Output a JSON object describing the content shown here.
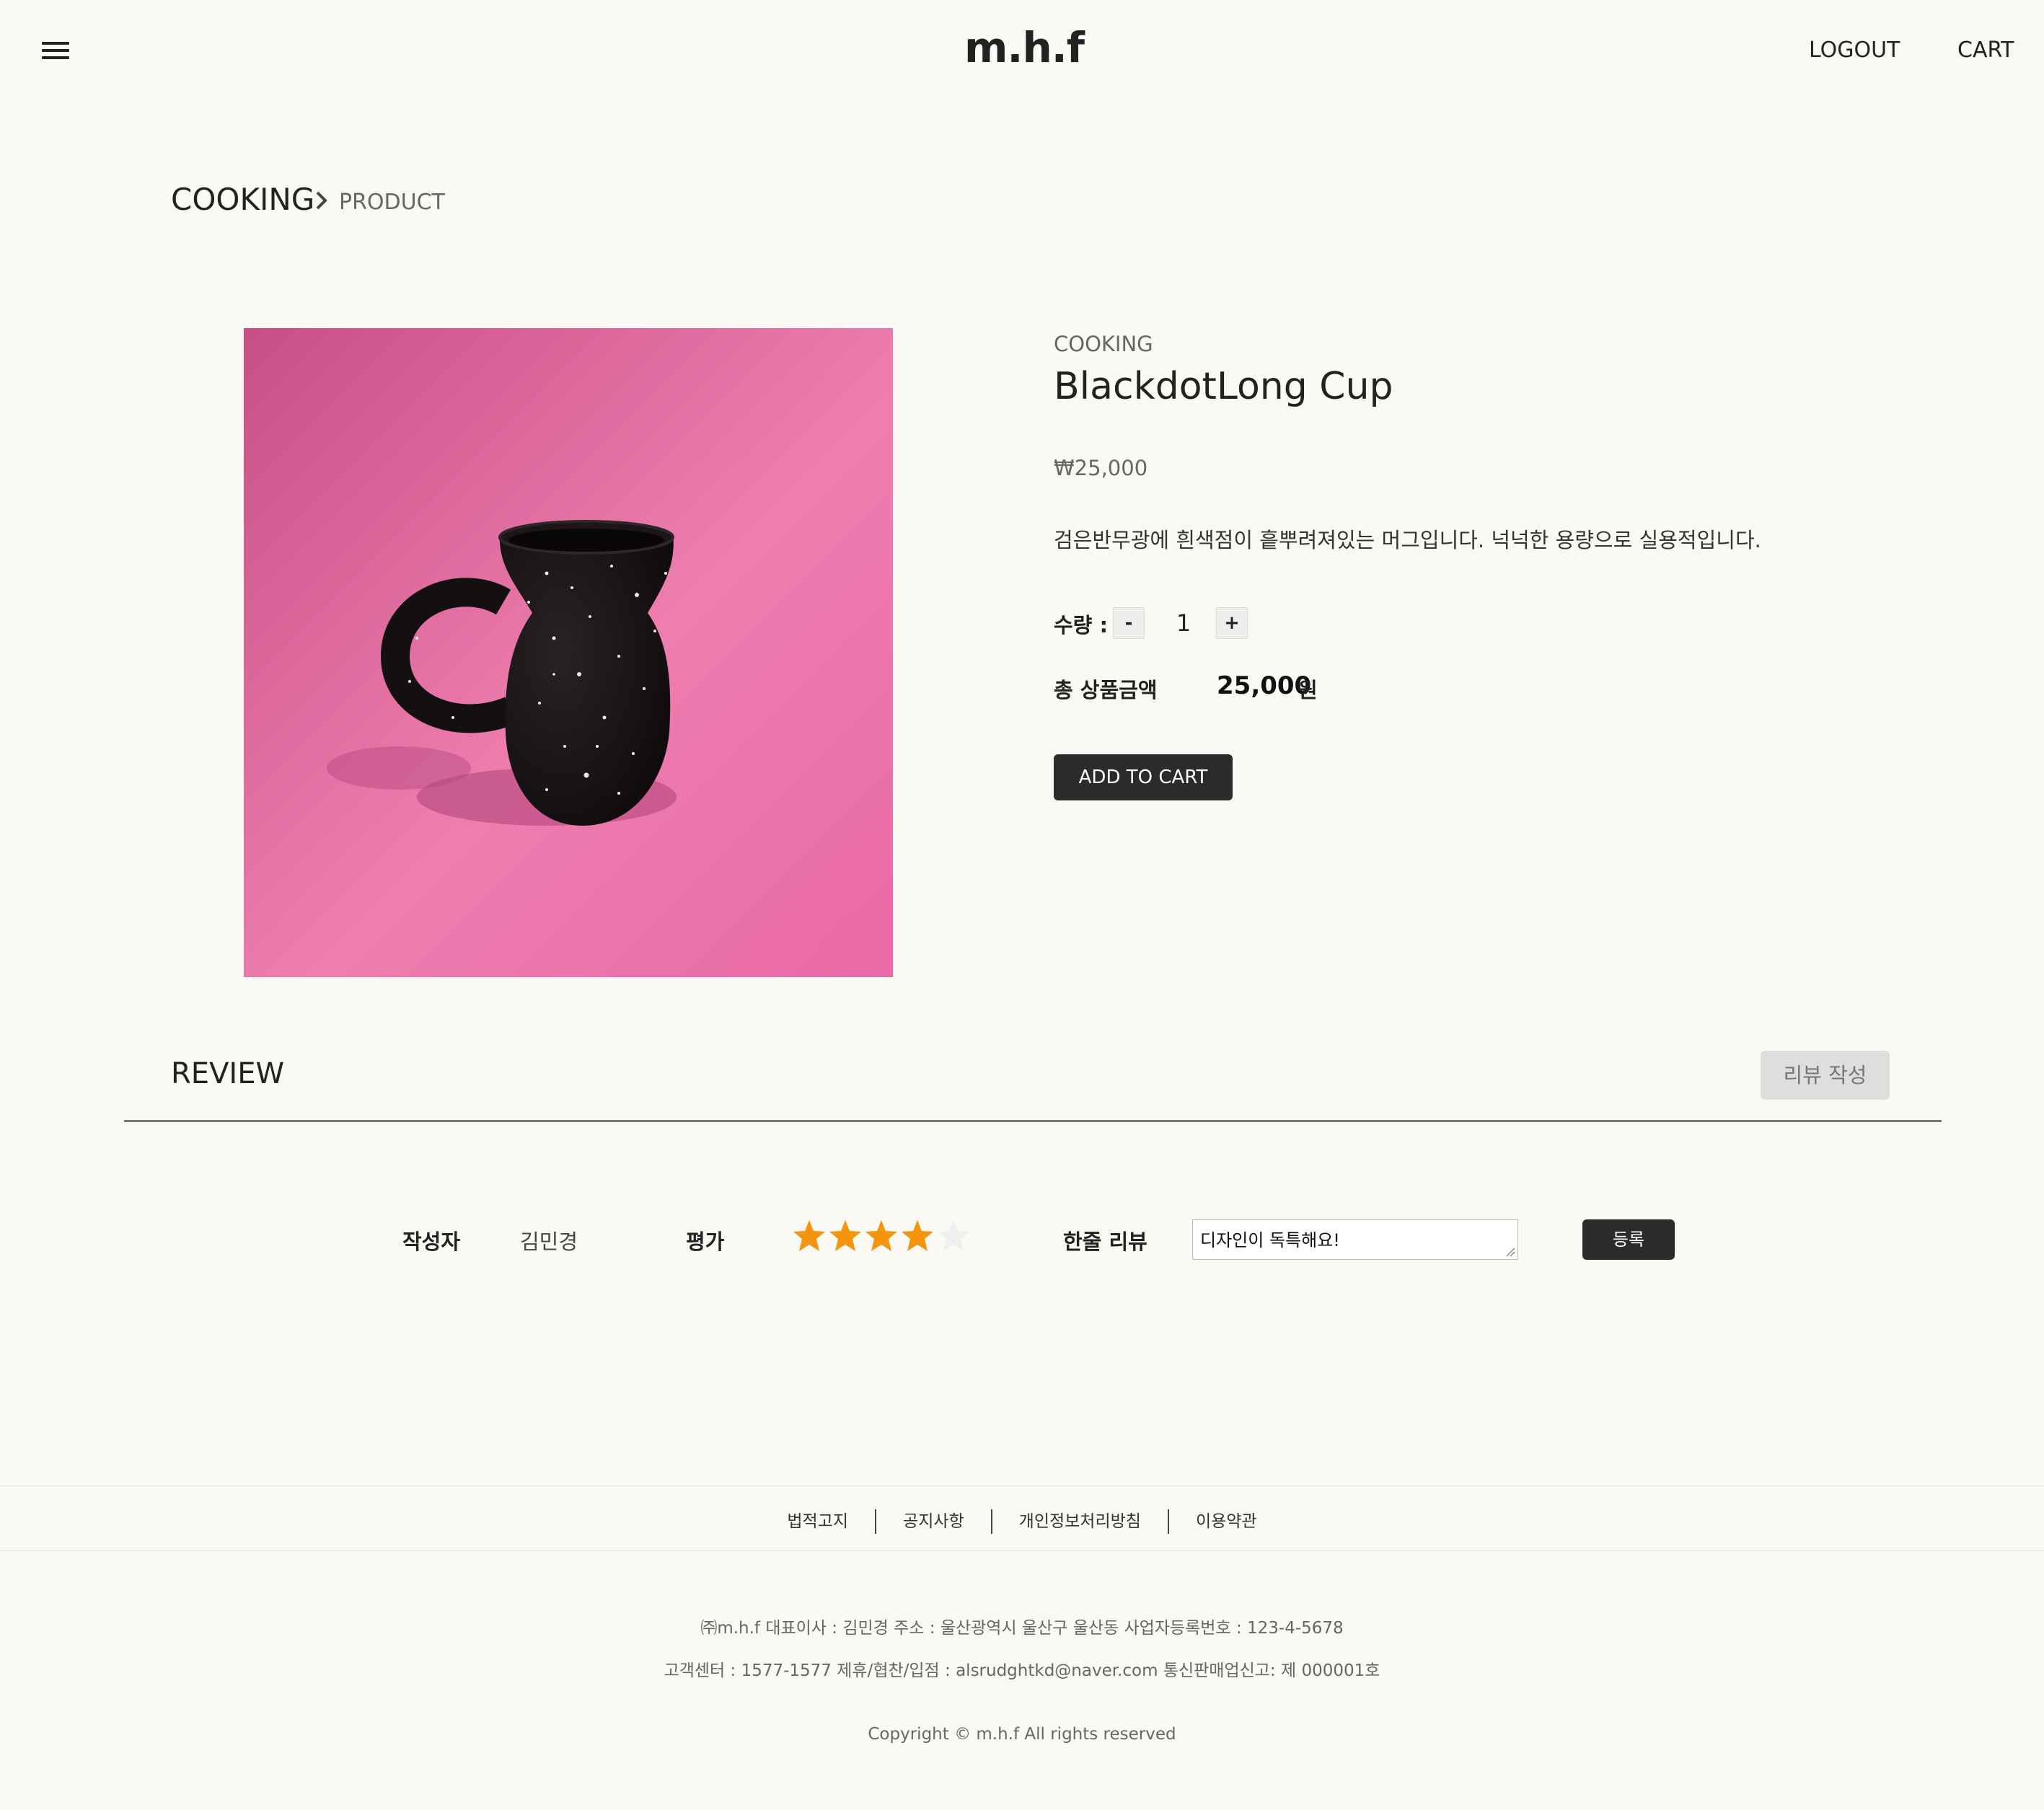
{
  "header": {
    "logo": "m.h.f",
    "logout_label": "LOGOUT",
    "cart_label": "CART"
  },
  "breadcrumb": {
    "category": "COOKING",
    "current": "PRODUCT"
  },
  "product": {
    "category": "COOKING",
    "name": "BlackdotLong Cup",
    "price": "₩25,000",
    "description": "검은반무광에 흰색점이 흩뿌려져있는 머그입니다. 넉넉한 용량으로 실용적입니다.",
    "quantity_label": "수량 :",
    "minus_label": "-",
    "quantity": "1",
    "plus_label": "+",
    "total_label": "총 상품금액",
    "total_value": "25,000",
    "total_unit": "원",
    "add_to_cart_label": "ADD TO CART",
    "image_colors": {
      "background": "#e565a0",
      "mug": "#141012"
    }
  },
  "review": {
    "title": "REVIEW",
    "write_label": "리뷰 작성",
    "entry": {
      "author_label": "작성자",
      "author": "김민경",
      "rating_label": "평가",
      "rating": 4,
      "rating_max": 5,
      "line_review_label": "한줄 리뷰",
      "line_review_value": "디자인이  독특해요!",
      "submit_label": "등록"
    },
    "star_colors": {
      "filled": "#f5940f",
      "empty": "#efefef"
    }
  },
  "footer": {
    "links": [
      "법적고지",
      "공지사항",
      "개인정보처리방침",
      "이용약관"
    ],
    "info_line1": "㈜m.h.f 대표이사 : 김민경 주소 : 울산광역시 울산구 울산동 사업자등록번호 : 123-4-5678",
    "info_line2": "고객센터 : 1577-1577 제휴/협찬/입점 : alsrudghtkd@naver.com 통신판매업신고: 제 000001호",
    "copyright": "Copyright © m.h.f All rights reserved"
  }
}
